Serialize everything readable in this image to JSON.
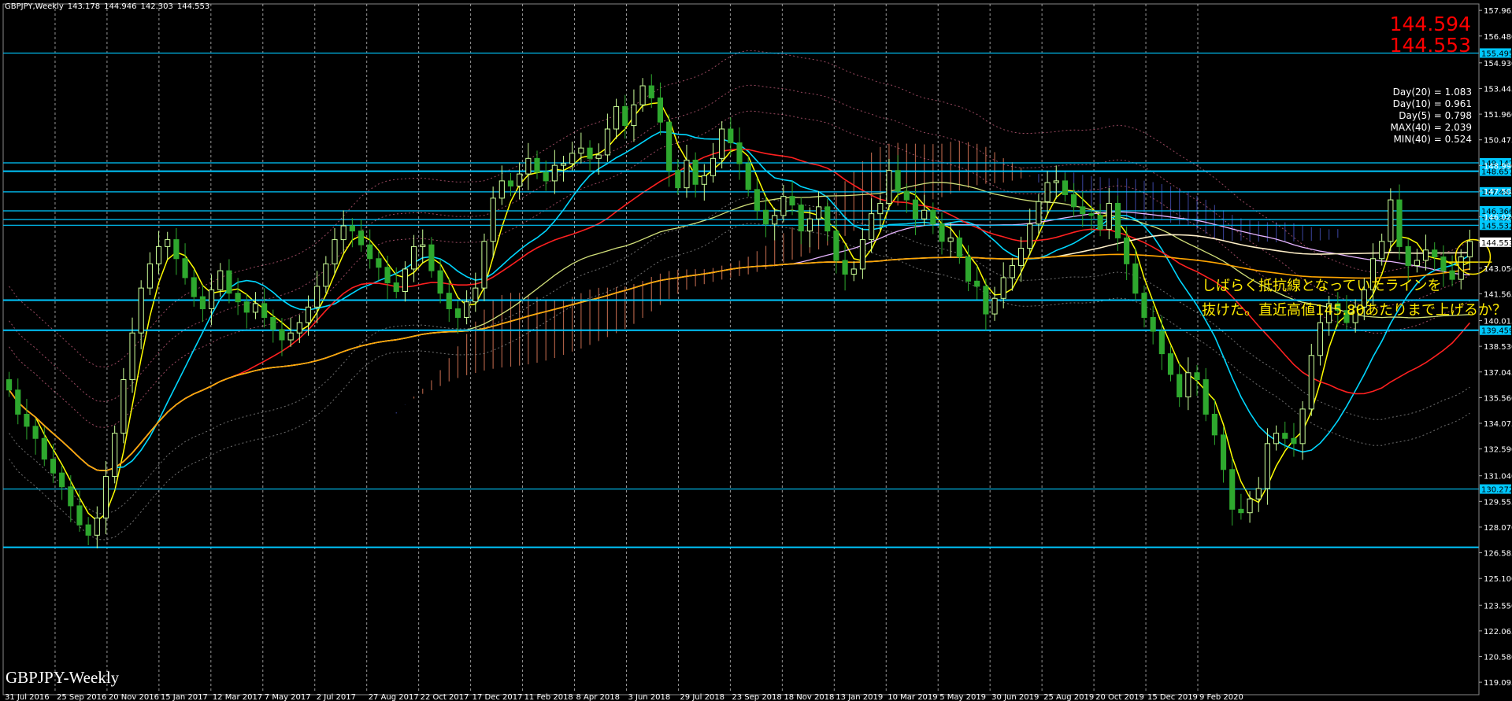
{
  "header": {
    "symbol": "GBPJPY,Weekly",
    "open": "143.178",
    "high": "144.946",
    "low": "142.303",
    "close": "144.553"
  },
  "watermark": "GBPJPY-Weekly",
  "quote": {
    "ask": "144.594",
    "bid": "144.553"
  },
  "stats": [
    "Day(20) = 1.083",
    "Day(10) = 0.961",
    "Day(5) = 0.798",
    "MAX(40) = 2.039",
    "MIN(40) = 0.524"
  ],
  "annotation": {
    "line1": "しばらく抵抗線となっていたラインを",
    "line2": "抜けた。直近高値145.80あたりまで上げるか？"
  },
  "colors": {
    "background": "#000000",
    "bull_candle": "#ccff99",
    "bear_candle": "#2ea82e",
    "hline": "#00c8ff",
    "grid": "#c8c8c8",
    "sma_short": "#ffff00",
    "sma_mid": "#00d7ff",
    "sma_long": "#ff2020",
    "sma_200": "#ffa500",
    "annotation": "#ffeb00"
  },
  "chart_data": {
    "type": "candlestick",
    "symbol": "GBPJPY",
    "timeframe": "Weekly",
    "ylim": [
      118.6,
      158.2
    ],
    "y_ticks": [
      "157.965",
      "156.480",
      "154.930",
      "153.445",
      "151.960",
      "150.475",
      "148.990",
      "147.505",
      "146.020",
      "144.535",
      "143.050",
      "141.565",
      "140.015",
      "138.530",
      "137.045",
      "135.560",
      "134.075",
      "132.590",
      "131.040",
      "129.555",
      "128.070",
      "126.585",
      "125.100",
      "123.550",
      "122.065",
      "120.580",
      "119.095"
    ],
    "x_labels": [
      "31 Jul 2016",
      "25 Sep 2016",
      "20 Nov 2016",
      "15 Jan 2017",
      "12 Mar 2017",
      "7 May 2017",
      "2 Jul 2017",
      "27 Aug 2017",
      "22 Oct 2017",
      "17 Dec 2017",
      "11 Feb 2018",
      "8 Apr 2018",
      "3 Jun 2018",
      "29 Jul 2018",
      "23 Sep 2018",
      "18 Nov 2018",
      "13 Jan 2019",
      "10 Mar 2019",
      "5 May 2019",
      "30 Jun 2019",
      "25 Aug 2019",
      "20 Oct 2019",
      "15 Dec 2019",
      "9 Feb 2020"
    ],
    "horizontal_lines": [
      {
        "label": "155.495",
        "value": 155.495
      },
      {
        "label": "149.142",
        "value": 149.142
      },
      {
        "label": "148.657",
        "value": 148.657
      },
      {
        "label": "147.465",
        "value": 147.465
      },
      {
        "label": "146.366",
        "value": 146.366
      },
      {
        "label": "145.865",
        "value": 145.865
      },
      {
        "label": "145.532",
        "value": 145.532
      },
      {
        "label": "139.459",
        "value": 139.459
      },
      {
        "label": "130.272",
        "value": 130.272
      },
      {
        "label": "",
        "value": 141.2
      },
      {
        "label": "",
        "value": 126.9
      }
    ],
    "current_price_label": "144.553",
    "current_price": 144.553,
    "closes": [
      136.0,
      134.6,
      133.9,
      133.2,
      132.0,
      131.2,
      130.4,
      129.3,
      128.2,
      127.6,
      128.6,
      131.0,
      133.5,
      136.6,
      139.3,
      141.9,
      143.3,
      144.3,
      144.7,
      143.6,
      142.5,
      141.4,
      140.7,
      141.8,
      142.9,
      141.6,
      141.1,
      140.5,
      141.0,
      140.2,
      139.5,
      138.9,
      139.3,
      139.9,
      140.8,
      142.0,
      143.3,
      144.7,
      145.5,
      145.2,
      144.4,
      143.6,
      143.1,
      142.2,
      141.7,
      143.0,
      144.3,
      144.4,
      142.9,
      141.6,
      140.7,
      140.2,
      141.1,
      141.9,
      144.6,
      147.1,
      148.1,
      147.8,
      148.5,
      149.4,
      148.6,
      148.1,
      149.0,
      149.1,
      149.7,
      150.0,
      149.4,
      149.6,
      151.1,
      152.4,
      151.3,
      152.5,
      153.6,
      152.9,
      151.5,
      148.7,
      147.7,
      149.3,
      147.9,
      148.4,
      149.4,
      151.1,
      150.3,
      149.1,
      147.6,
      146.4,
      145.6,
      146.1,
      147.2,
      146.7,
      145.2,
      145.9,
      146.6,
      145.2,
      143.5,
      142.7,
      143.0,
      144.7,
      146.2,
      146.8,
      148.7,
      147.5,
      147.0,
      145.9,
      146.4,
      145.6,
      144.6,
      144.8,
      143.7,
      142.3,
      142.0,
      140.4,
      141.3,
      142.5,
      143.2,
      144.2,
      145.6,
      146.9,
      148.0,
      148.1,
      147.3,
      146.6,
      146.2,
      146.1,
      145.3,
      146.8,
      144.8,
      143.3,
      141.6,
      140.2,
      139.4,
      138.1,
      136.9,
      135.6,
      137.0,
      136.6,
      134.6,
      133.4,
      131.4,
      129.1,
      128.9,
      129.7,
      130.3,
      132.9,
      133.5,
      133.2,
      132.9,
      134.9,
      138.0,
      139.9,
      141.0,
      140.6,
      139.9,
      140.8,
      141.8,
      143.6,
      144.6,
      147.0,
      144.3,
      143.2,
      143.5,
      144.1,
      143.7,
      142.9,
      142.4,
      143.7,
      144.6
    ]
  }
}
